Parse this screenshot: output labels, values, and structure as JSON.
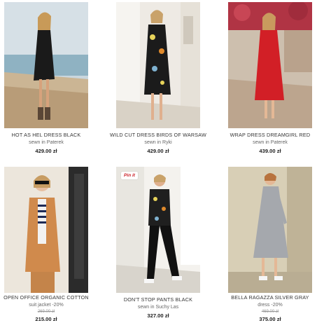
{
  "products": [
    {
      "name": "HOT AS HEL DRESS BLACK",
      "sub": "sewn in Paterek",
      "price": "429.00 zł"
    },
    {
      "name": "WILD CUT DRESS BIRDS OF WARSAW",
      "sub": "sewn in Ryki",
      "price": "429.00 zł"
    },
    {
      "name": "WRAP DRESS DREAMGIRL RED",
      "sub": "sewn in Paterek",
      "price": "439.00 zł"
    },
    {
      "name": "OPEN OFFICE ORGANIC COTTON",
      "sub": "suit jacket -20%",
      "old_price": "269.00 zł",
      "price": "215.00 zł"
    },
    {
      "name": "DON'T STOP PANTS BLACK",
      "sub": "sewn in Suchy Las",
      "price": "327.00 zł",
      "pin_label": "Pin it"
    },
    {
      "name": "BELLA RAGAZZA SILVER GRAY",
      "sub": "dress -20%",
      "old_price": "469.00 zł",
      "price": "375.00 zł"
    }
  ]
}
